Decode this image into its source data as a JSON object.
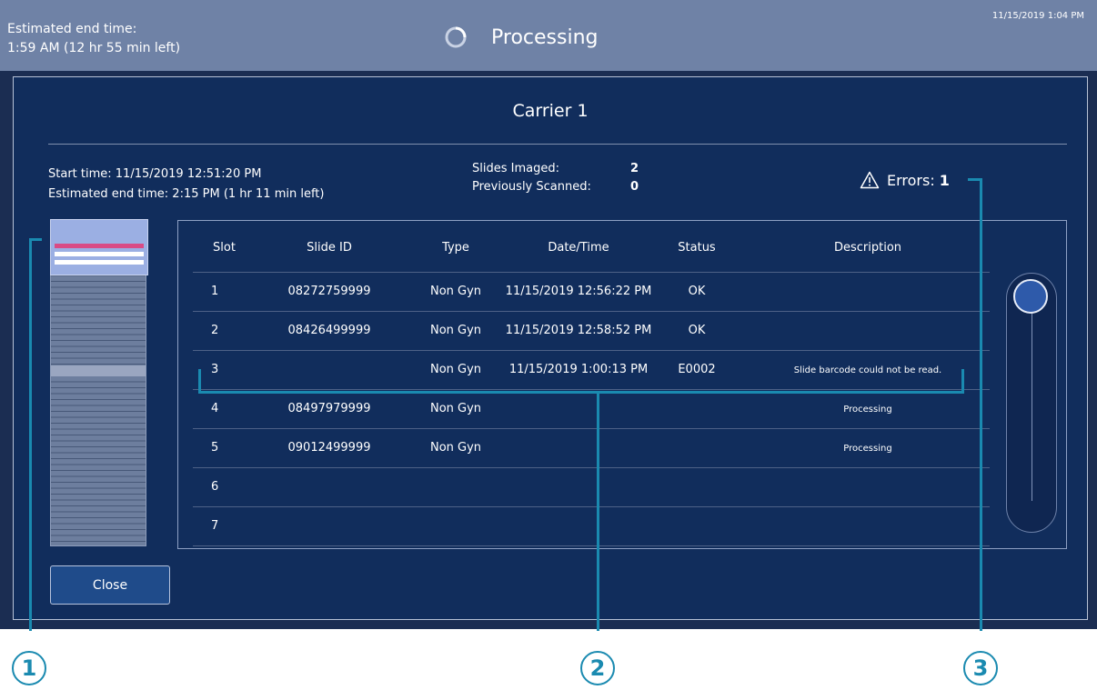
{
  "header": {
    "estimated_label": "Estimated end time:",
    "estimated_value": "1:59 AM (12 hr 55 min left)",
    "title": "Processing",
    "clock": "11/15/2019 1:04 PM"
  },
  "dialog": {
    "title": "Carrier 1",
    "start_time": "Start time:  11/15/2019 12:51:20 PM",
    "end_time": "Estimated end time:  2:15 PM (1 hr 11 min left)",
    "slides_imaged_label": "Slides Imaged:",
    "slides_imaged_value": "2",
    "previously_scanned_label": "Previously Scanned:",
    "previously_scanned_value": "0",
    "errors_label": "Errors:",
    "errors_value": "1",
    "close_label": "Close"
  },
  "table": {
    "columns": [
      "Slot",
      "Slide ID",
      "Type",
      "Date/Time",
      "Status",
      "Description"
    ],
    "rows": [
      {
        "slot": "1",
        "slide_id": "08272759999",
        "type": "Non Gyn",
        "datetime": "11/15/2019 12:56:22 PM",
        "status": "OK",
        "description": ""
      },
      {
        "slot": "2",
        "slide_id": "08426499999",
        "type": "Non Gyn",
        "datetime": "11/15/2019 12:58:52 PM",
        "status": "OK",
        "description": ""
      },
      {
        "slot": "3",
        "slide_id": "",
        "type": "Non Gyn",
        "datetime": "11/15/2019 1:00:13 PM",
        "status": "E0002",
        "description": "Slide barcode could not be read."
      },
      {
        "slot": "4",
        "slide_id": "08497979999",
        "type": "Non Gyn",
        "datetime": "",
        "status": "",
        "description": "Processing"
      },
      {
        "slot": "5",
        "slide_id": "09012499999",
        "type": "Non Gyn",
        "datetime": "",
        "status": "",
        "description": "Processing"
      },
      {
        "slot": "6",
        "slide_id": "",
        "type": "",
        "datetime": "",
        "status": "",
        "description": ""
      },
      {
        "slot": "7",
        "slide_id": "",
        "type": "",
        "datetime": "",
        "status": "",
        "description": ""
      }
    ]
  },
  "carrier_map": {
    "slot_colors": [
      "#d94b86",
      "#ffffff",
      "#ffffff"
    ]
  },
  "callouts": [
    "1",
    "2",
    "3"
  ],
  "icons": {
    "spinner": "loading-spinner-icon",
    "warning": "warning-triangle-icon"
  },
  "colors": {
    "header_bg": "#6f82a6",
    "dialog_bg": "#112d5c",
    "callout": "#1a8ab0",
    "error_slot": "#d94b86"
  }
}
